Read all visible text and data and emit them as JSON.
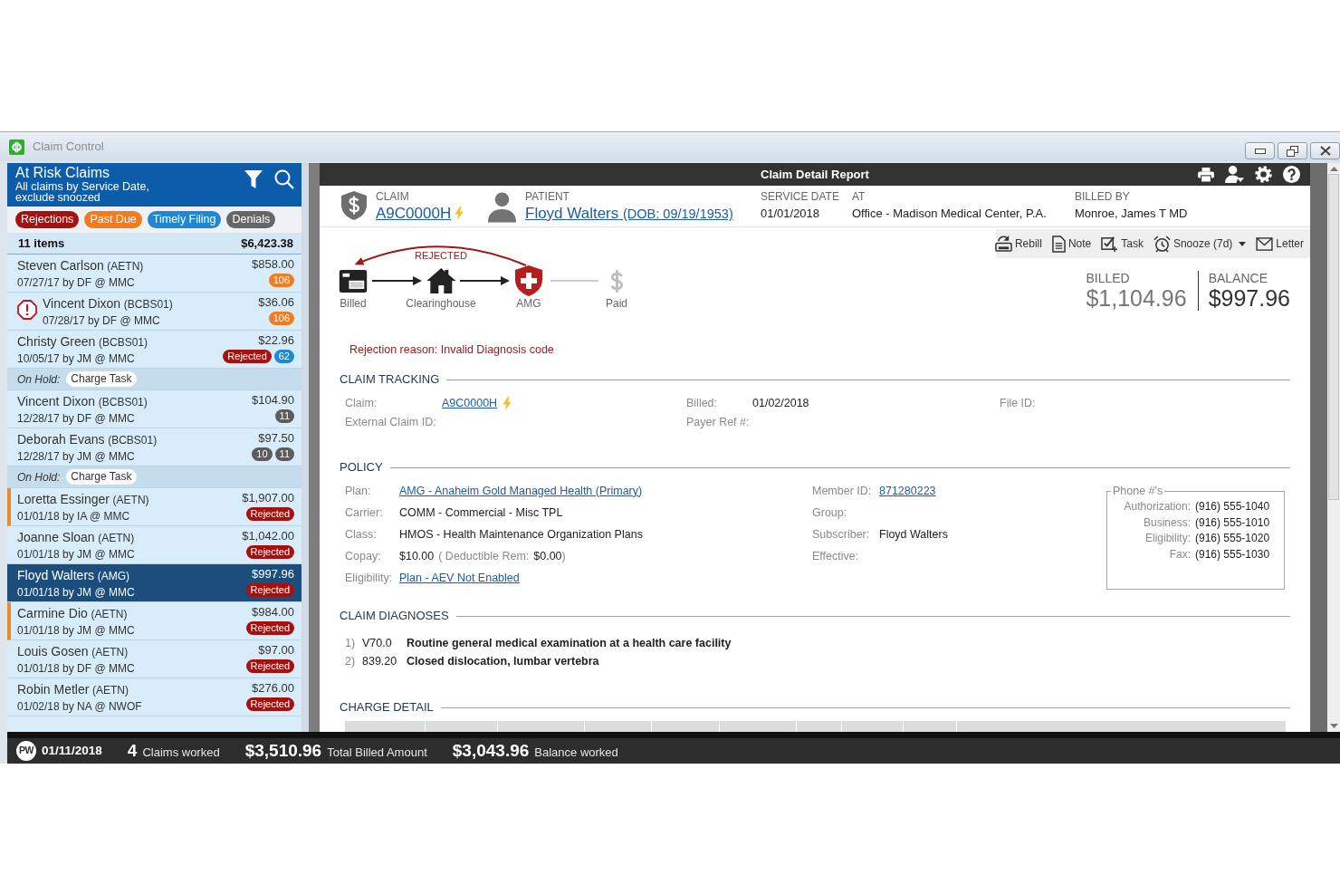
{
  "window": {
    "title": "Claim Control"
  },
  "queue": {
    "title": "At Risk Claims",
    "subtitle": "All claims by Service Date, exclude snoozed",
    "filters": [
      {
        "label": "Rejections",
        "color": "#a3120f"
      },
      {
        "label": "Past Due",
        "color": "#f47b20"
      },
      {
        "label": "Timely Filing",
        "color": "#1f88d6"
      },
      {
        "label": "Denials",
        "color": "#666666"
      }
    ],
    "summary": {
      "count": "11 items",
      "total": "$6,423.38"
    },
    "items": [
      {
        "name": "Steven Carlson",
        "payer": "(AETN)",
        "detail": "07/27/17 by DF @ MMC",
        "amount": "$858.00",
        "badges": [
          {
            "text": "106",
            "color": "#f47b20"
          }
        ],
        "alert": false,
        "flagged": false,
        "selected": false
      },
      {
        "name": "Vincent Dixon",
        "payer": "(BCBS01)",
        "detail": "07/28/17 by DF @ MMC",
        "amount": "$36.06",
        "badges": [
          {
            "text": "106",
            "color": "#f47b20"
          }
        ],
        "alert": true,
        "flagged": false,
        "selected": false
      },
      {
        "name": "Christy Green",
        "payer": "(BCBS01)",
        "detail": "10/05/17 by JM @ MMC",
        "amount": "$22.96",
        "badges": [
          {
            "text": "Rejected",
            "color": "#a3120f"
          },
          {
            "text": "62",
            "color": "#1f88d6"
          }
        ],
        "alert": false,
        "flagged": false,
        "selected": false,
        "hold": {
          "label": "On Hold:",
          "task": "Charge Task"
        }
      },
      {
        "name": "Vincent Dixon",
        "payer": "(BCBS01)",
        "detail": "12/28/17 by DF @ MMC",
        "amount": "$104.90",
        "badges": [
          {
            "text": "11",
            "color": "#5c5c5c"
          }
        ],
        "alert": false,
        "flagged": false,
        "selected": false
      },
      {
        "name": "Deborah Evans",
        "payer": "(BCBS01)",
        "detail": "12/28/17 by JM @ MMC",
        "amount": "$97.50",
        "badges": [
          {
            "text": "10",
            "color": "#5c5c5c"
          },
          {
            "text": "11",
            "color": "#5c5c5c"
          }
        ],
        "alert": false,
        "flagged": false,
        "selected": false,
        "hold": {
          "label": "On Hold:",
          "task": "Charge Task"
        }
      },
      {
        "name": "Loretta Essinger",
        "payer": "(AETN)",
        "detail": "01/01/18 by IA @ MMC",
        "amount": "$1,907.00",
        "badges": [
          {
            "text": "Rejected",
            "color": "#a3120f"
          }
        ],
        "alert": false,
        "flagged": true,
        "selected": false
      },
      {
        "name": "Joanne Sloan",
        "payer": "(AETN)",
        "detail": "01/01/18 by JM @ MMC",
        "amount": "$1,042.00",
        "badges": [
          {
            "text": "Rejected",
            "color": "#a3120f"
          }
        ],
        "alert": false,
        "flagged": false,
        "selected": false
      },
      {
        "name": "Floyd Walters",
        "payer": "(AMG)",
        "detail": "01/01/18 by JM @ MMC",
        "amount": "$997.96",
        "badges": [
          {
            "text": "Rejected",
            "color": "#a3120f"
          }
        ],
        "alert": false,
        "flagged": false,
        "selected": true
      },
      {
        "name": "Carmine Dio",
        "payer": "(AETN)",
        "detail": "01/01/18 by JM @ MMC",
        "amount": "$984.00",
        "badges": [
          {
            "text": "Rejected",
            "color": "#a3120f"
          }
        ],
        "alert": false,
        "flagged": true,
        "selected": false
      },
      {
        "name": "Louis Gosen",
        "payer": "(AETN)",
        "detail": "01/01/18 by DF @ MMC",
        "amount": "$97.00",
        "badges": [
          {
            "text": "Rejected",
            "color": "#a3120f"
          }
        ],
        "alert": false,
        "flagged": false,
        "selected": false
      },
      {
        "name": "Robin Metler",
        "payer": "(AETN)",
        "detail": "01/02/18 by NA @ NWOF",
        "amount": "$276.00",
        "badges": [
          {
            "text": "Rejected",
            "color": "#a3120f"
          }
        ],
        "alert": false,
        "flagged": false,
        "selected": false
      }
    ]
  },
  "report": {
    "title": "Claim Detail Report",
    "claim": {
      "label": "CLAIM",
      "number": "A9C0000H",
      "marked": true
    },
    "patient": {
      "label": "PATIENT",
      "name": "Floyd Walters",
      "dob": "(DOB: 09/19/1953)"
    },
    "facts": [
      {
        "label": "SERVICE DATE",
        "value": "01/01/2018"
      },
      {
        "label": "AT",
        "value": "Office - Madison Medical Center, P.A."
      },
      {
        "label": "BILLED BY",
        "value": "Monroe, James T MD"
      }
    ],
    "actions": [
      {
        "label": "Rebill",
        "menu": false
      },
      {
        "label": "Note",
        "menu": false
      },
      {
        "label": "Task",
        "menu": false
      },
      {
        "label": "Snooze (7d)",
        "menu": true
      },
      {
        "label": "Letter",
        "menu": false
      }
    ],
    "workflow": {
      "steps": [
        {
          "label": "Billed",
          "reached": true,
          "rejected": false
        },
        {
          "label": "Clearinghouse",
          "reached": true,
          "rejected": false
        },
        {
          "label": "AMG",
          "reached": true,
          "rejected": true
        },
        {
          "label": "Paid",
          "reached": false,
          "rejected": false
        }
      ],
      "return_label": "REJECTED"
    },
    "totals": [
      {
        "label": "BILLED",
        "value": "$1,104.96",
        "emphasis": false
      },
      {
        "label": "BALANCE",
        "value": "$997.96",
        "emphasis": true
      }
    ],
    "rejection_reason": "Rejection reason: Invalid Diagnosis code",
    "claim_tracking": {
      "title": "CLAIM TRACKING",
      "columns": [
        [
          {
            "label": "Claim:",
            "value": "A9C0000H",
            "link": true,
            "marked": true
          },
          {
            "label": "External Claim ID:"
          }
        ],
        [
          {
            "label": "Billed:",
            "value": "01/02/2018",
            "link": false,
            "marked": false
          },
          {
            "label": "Payer Ref #:"
          }
        ],
        [
          {
            "label": "File ID:"
          }
        ]
      ]
    },
    "policy": {
      "title": "POLICY",
      "columns": [
        [
          {
            "label": "Plan:",
            "value": "AMG - Anaheim Gold Managed Health (Primary)",
            "link": true
          },
          {
            "label": "Carrier:",
            "value": "COMM - Commercial - Misc TPL",
            "link": false
          },
          {
            "label": "Class:",
            "value": "HMOS - Health Maintenance Organization Plans",
            "link": false
          },
          {
            "label": "Copay:",
            "value": "$10.00",
            "link": false,
            "extra": {
              "label": "( Deductible Rem:",
              "value": "$0.00",
              "close": ")"
            }
          },
          {
            "label": "Eligibility:",
            "value": "Plan - AEV Not Enabled",
            "link": true
          }
        ],
        [
          {
            "label": "Member ID:",
            "value": "871280223",
            "link": true
          },
          {
            "label": "Group:"
          },
          {
            "label": "Subscriber:",
            "value": "Floyd Walters",
            "link": false
          },
          {
            "label": "Effective:"
          }
        ]
      ],
      "phones": {
        "title": "Phone #'s",
        "rows": [
          {
            "label": "Authorization:",
            "value": "(916) 555-1040"
          },
          {
            "label": "Business:",
            "value": "(916) 555-1010"
          },
          {
            "label": "Eligibility:",
            "value": "(916) 555-1020"
          },
          {
            "label": "Fax:",
            "value": "(916) 555-1030"
          }
        ]
      }
    },
    "diagnoses": {
      "title": "CLAIM DIAGNOSES",
      "items": [
        {
          "number": "1)",
          "code": "V70.0",
          "description": "Routine general medical examination at a health care facility"
        },
        {
          "number": "2)",
          "code": "839.20",
          "description": "Closed dislocation, lumbar vertebra"
        }
      ]
    },
    "charge_detail": {
      "title": "CHARGE DETAIL"
    }
  },
  "status_bar": {
    "initials": "PW",
    "date": "01/11/2018",
    "stats": [
      {
        "value": "4",
        "label": "Claims worked"
      },
      {
        "value": "$3,510.96",
        "label": "Total Billed Amount"
      },
      {
        "value": "$3,043.96",
        "label": "Balance worked"
      }
    ]
  }
}
